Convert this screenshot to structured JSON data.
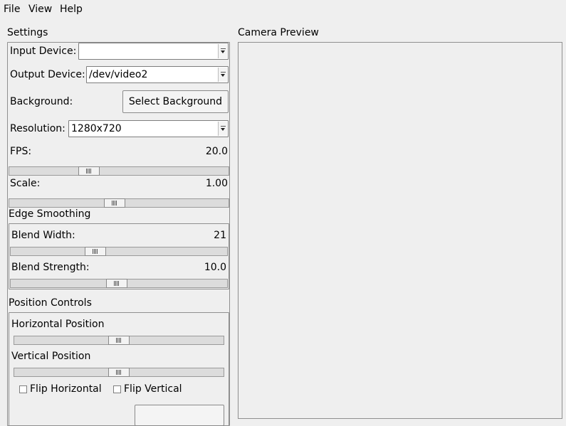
{
  "menu": {
    "file": "File",
    "view": "View",
    "help": "Help"
  },
  "settings": {
    "title": "Settings",
    "input_device": {
      "label": "Input Device:",
      "value": ""
    },
    "output_device": {
      "label": "Output Device:",
      "value": "/dev/video2"
    },
    "background": {
      "label": "Background:",
      "button": "Select Background"
    },
    "resolution": {
      "label": "Resolution:",
      "value": "1280x720"
    },
    "fps": {
      "label": "FPS:",
      "value": "20.0",
      "slider_fraction": 0.35
    },
    "scale": {
      "label": "Scale:",
      "value": "1.00",
      "slider_fraction": 0.48
    }
  },
  "edge_smoothing": {
    "title": "Edge Smoothing",
    "blend_width": {
      "label": "Blend Width:",
      "value": "21",
      "slider_fraction": 0.38
    },
    "blend_strength": {
      "label": "Blend Strength:",
      "value": "10.0",
      "slider_fraction": 0.49
    }
  },
  "position_controls": {
    "title": "Position Controls",
    "horizontal": {
      "label": "Horizontal Position",
      "slider_fraction": 0.5
    },
    "vertical": {
      "label": "Vertical Position",
      "slider_fraction": 0.5
    },
    "flip_horizontal": {
      "label": "Flip Horizontal",
      "checked": false
    },
    "flip_vertical": {
      "label": "Flip Vertical",
      "checked": false
    }
  },
  "preview": {
    "title": "Camera Preview"
  }
}
